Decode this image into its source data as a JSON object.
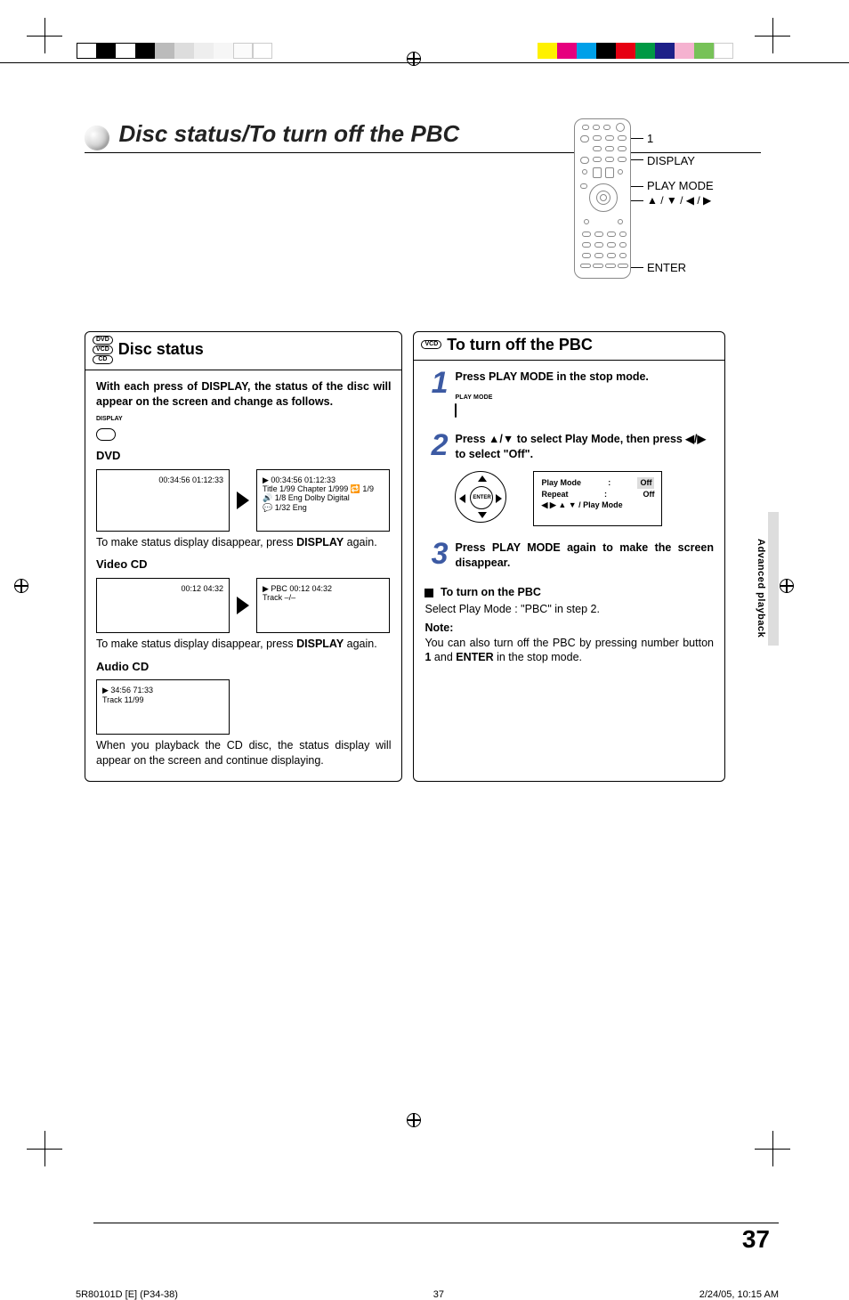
{
  "page_title": "Disc status/To turn off the PBC",
  "remote_labels": {
    "one": "1",
    "display": "DISPLAY",
    "playmode": "PLAY MODE",
    "arrows": "▲ / ▼ / ◀ / ▶",
    "enter": "ENTER"
  },
  "left": {
    "badges": [
      "DVD",
      "VCD",
      "CD"
    ],
    "heading": "Disc status",
    "intro_a": "With each press of DISPLAY, the status of the disc will appear on the screen and change as follows.",
    "display_label": "DISPLAY",
    "dvd_h": "DVD",
    "dvd_screen1": "00:34:56  01:12:33",
    "dvd_screen2": {
      "l1": "▶                               00:34:56  01:12:33",
      "l2": "Title      1/99   Chapter  1/999   🔁 1/9",
      "l3": "🔊 1/8  Eng Dolby Digital",
      "l4": "💬 1/32 Eng"
    },
    "dvd_note_a": "To make status display disappear, press ",
    "dvd_note_b": "DISPLAY",
    "dvd_note_c": " again.",
    "vcd_h": "Video CD",
    "vcd_screen1": "00:12      04:32",
    "vcd_screen2": {
      "l1": "▶ PBC                       00:12      04:32",
      "l2": "Track   –/–"
    },
    "vcd_note_a": "To make status display disappear, press ",
    "vcd_note_b": "DISPLAY",
    "vcd_note_c": " again.",
    "acd_h": "Audio CD",
    "acd_screen": {
      "l1": "▶                         34:56      71:33",
      "l2": "Track 11/99"
    },
    "acd_note": "When you playback the CD disc, the status display will appear on the screen and continue displaying."
  },
  "right": {
    "badge": "VCD",
    "heading": "To turn off the PBC",
    "step1": {
      "num": "1",
      "text": "Press PLAY MODE in the stop mode.",
      "btn_label": "PLAY MODE"
    },
    "step2": {
      "num": "2",
      "text_a": "Press ",
      "text_b": "▲/▼",
      "text_c": " to select Play Mode, then press ",
      "text_d": "◀/▶",
      "text_e": " to select \"Off\".",
      "dpad_center": "ENTER",
      "osd": {
        "r1a": "Play Mode",
        "r1b": ":",
        "r1c": "Off",
        "r2a": "Repeat",
        "r2b": ":",
        "r2c": "Off",
        "r3": "◀ ▶ ▲ ▼ / Play Mode"
      }
    },
    "step3": {
      "num": "3",
      "text": "Press PLAY MODE again to make the screen disappear."
    },
    "turn_on_h": "To turn on the PBC",
    "turn_on_body": "Select Play Mode : \"PBC\" in step 2.",
    "note_h": "Note:",
    "note_a": "You can also turn off the PBC by pressing number button ",
    "note_b": "1",
    "note_c": " and ",
    "note_d": "ENTER",
    "note_e": " in the stop mode."
  },
  "side_tab": "Advanced playback",
  "page_number": "37",
  "footer": {
    "left": "5R80101D [E] (P34-38)",
    "center": "37",
    "right": "2/24/05, 10:15 AM"
  }
}
